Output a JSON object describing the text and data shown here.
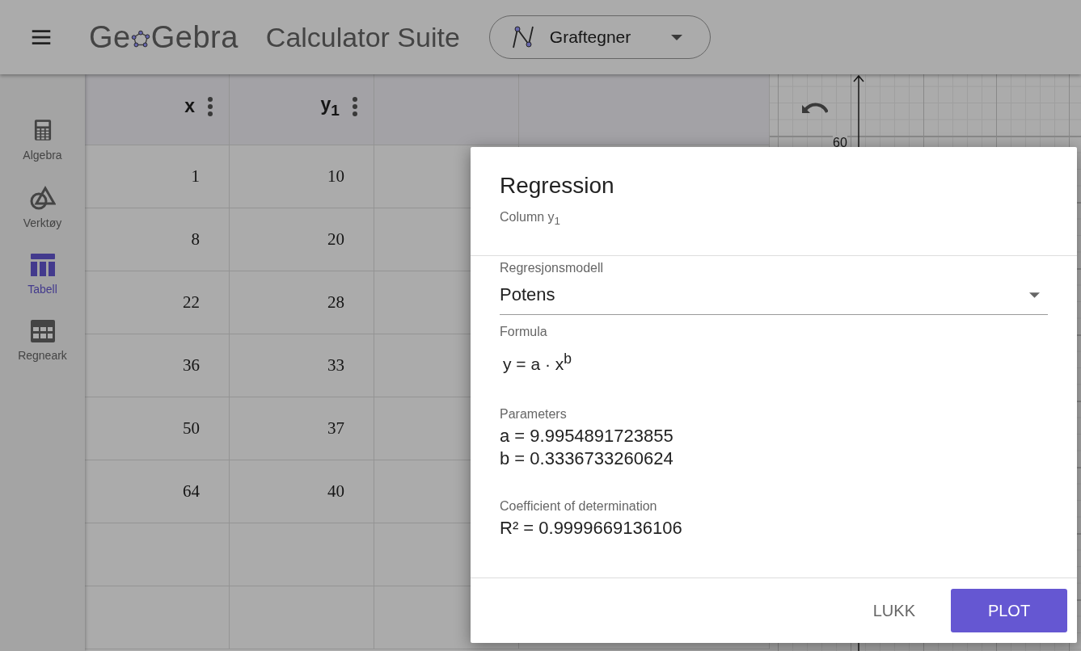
{
  "header": {
    "logo_parts": [
      "Ge",
      "Gebra"
    ],
    "suite_title": "Calculator Suite",
    "app_switcher": {
      "label": "Graftegner"
    }
  },
  "sidebar": {
    "items": [
      {
        "label": "Algebra",
        "kind": "calculator",
        "selected": false
      },
      {
        "label": "Verktøy",
        "kind": "shapes",
        "selected": false
      },
      {
        "label": "Tabell",
        "kind": "table",
        "selected": true
      },
      {
        "label": "Regneark",
        "kind": "sheet",
        "selected": false
      }
    ]
  },
  "table": {
    "columns": [
      {
        "label": "x"
      },
      {
        "label": "y$_{1}$"
      }
    ],
    "rows": [
      [
        "1",
        "10"
      ],
      [
        "8",
        "20"
      ],
      [
        "22",
        "28"
      ],
      [
        "36",
        "33"
      ],
      [
        "50",
        "37"
      ],
      [
        "64",
        "40"
      ]
    ]
  },
  "graphics": {
    "tick_labels": [
      "60"
    ]
  },
  "dialog": {
    "title": "Regression",
    "subtitle": "Column y$_{1}$",
    "model_label": "Regresjonsmodell",
    "model_value": "Potens",
    "formula_label": "Formula",
    "formula": "y = a · x$^{b}$",
    "parameters_label": "Parameters",
    "parameters": [
      "a = 9.9954891723855",
      "b = 0.3336733260624"
    ],
    "coefficient_label": "Coefficient of determination",
    "coefficient": "R² = 0.9999669136106",
    "buttons": [
      {
        "label": "LUKK",
        "kind": "text"
      },
      {
        "label": "PLOT",
        "kind": "filled"
      }
    ]
  }
}
